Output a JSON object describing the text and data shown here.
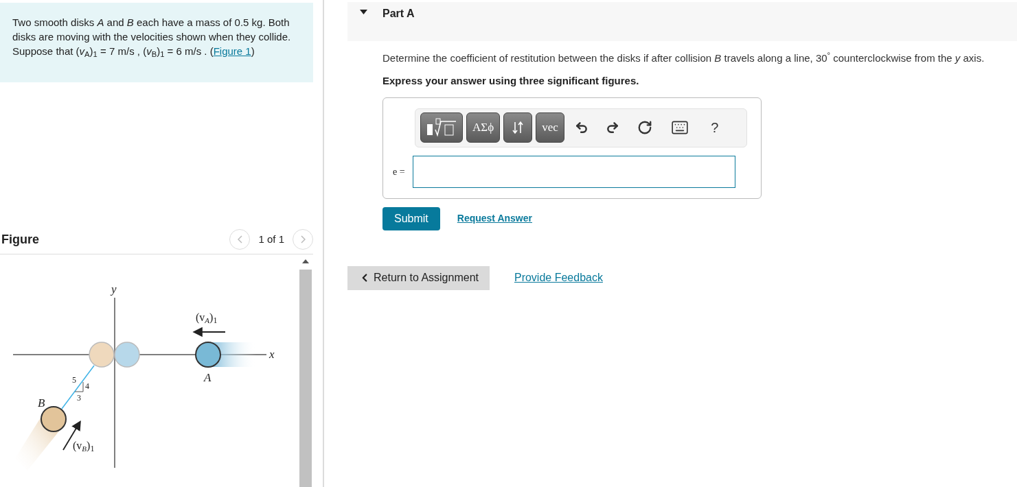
{
  "problem": {
    "text": "Two smooth disks *A* and *B* each have a mass of 0.5 kg. Both disks are moving with the velocities shown when they collide. Suppose that (*v*$_{A}$)$_{1}$ = 7  m/s , (*v*$_{B}$)$_{1}$ = 6  m/s .",
    "link_before": "(",
    "link": "Figure 1",
    "link_after": ")"
  },
  "figure": {
    "title": "Figure",
    "pager": "1 of 1",
    "prev_disabled": true,
    "next_disabled": true,
    "labels": {
      "y": "y",
      "x": "x",
      "a": "A",
      "b": "B",
      "slope_hyp": "5",
      "slope_rise": "4",
      "slope_run": "3"
    },
    "va": {
      "open": "(v",
      "sub": "A",
      "close": ")",
      "index": "1"
    },
    "vb": {
      "open": "(v",
      "sub": "B",
      "close": ")",
      "index": "1"
    }
  },
  "part": {
    "title": "Part A",
    "expanded": true,
    "question": "Determine the coefficient of restitution between the disks if after collision *B* travels along a line, 30$^{°}$ counterclockwise from the *y* axis.",
    "instruction": "Express your answer using three significant figures.",
    "toolbar": [
      {
        "kind": "template"
      },
      {
        "kind": "text",
        "label": "ΑΣϕ"
      },
      {
        "kind": "arrows"
      },
      {
        "kind": "text",
        "label": "vec"
      },
      {
        "kind": "undo"
      },
      {
        "kind": "redo"
      },
      {
        "kind": "reset"
      },
      {
        "kind": "keyboard"
      },
      {
        "kind": "help",
        "label": "?"
      }
    ],
    "answer_label": "e =",
    "submit": "Submit",
    "request": "Request Answer"
  },
  "footer": {
    "return": "Return to Assignment",
    "feedback": "Provide Feedback"
  }
}
